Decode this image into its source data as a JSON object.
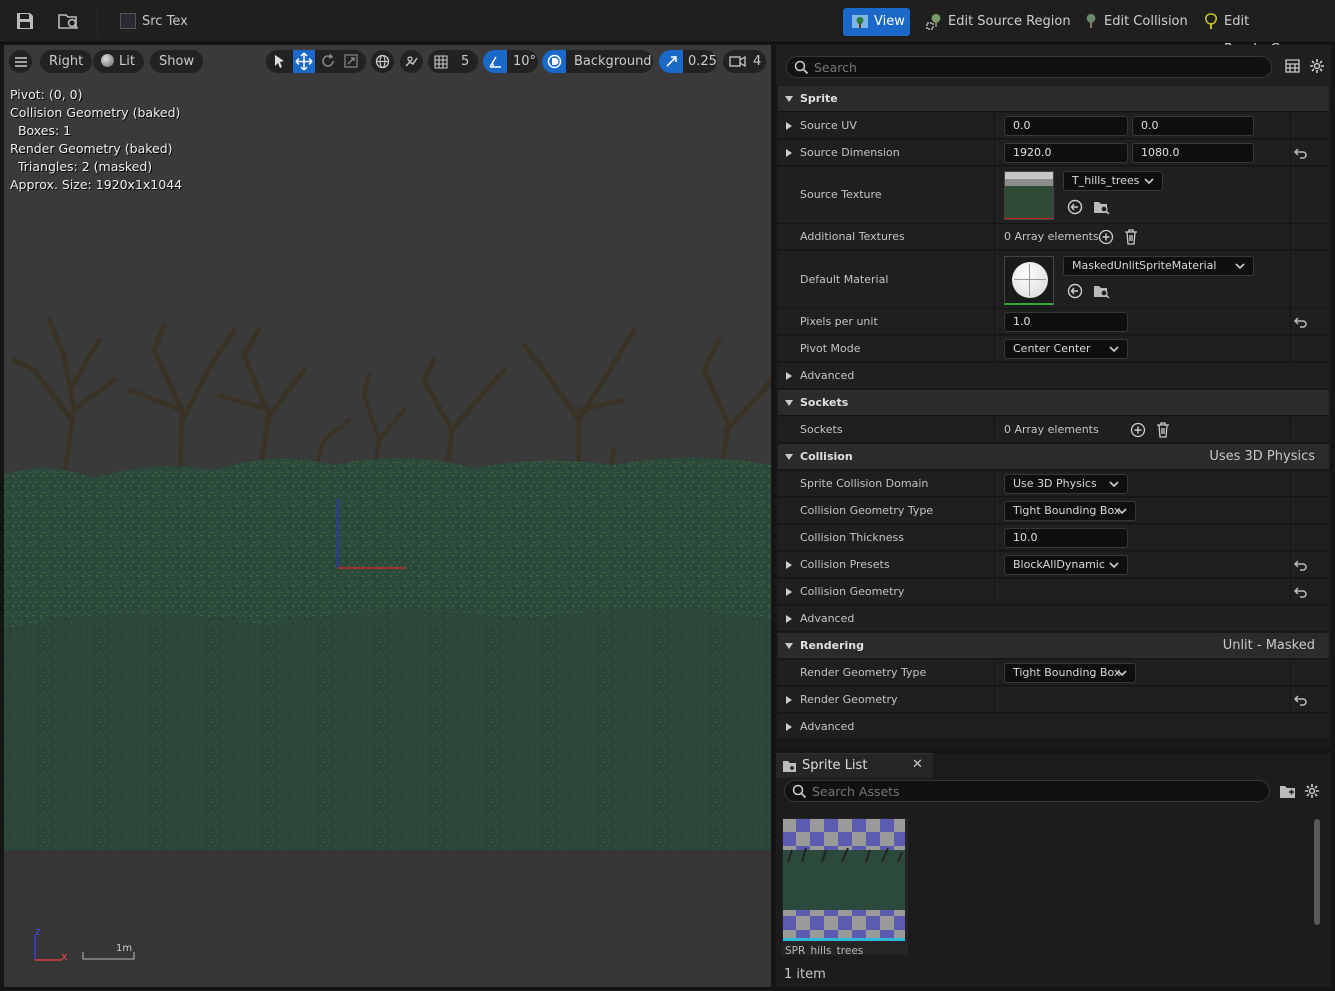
{
  "toolbar": {
    "source_texture_tab": "Src Tex",
    "modes": {
      "view": "View",
      "edit_source_region": "Edit Source Region",
      "edit_collision": "Edit Collision",
      "edit_render_geom": "Edit RenderGeom"
    }
  },
  "viewport": {
    "view_mode": "Right",
    "lighting": "Lit",
    "show": "Show",
    "grid_snap": "5",
    "rotation_snap": "10°",
    "background": "Background",
    "scale_snap": "0.25",
    "camera_speed": "4",
    "info": {
      "pivot": "Pivot: (0, 0)",
      "collision_geometry": "Collision Geometry (baked)",
      "boxes": "  Boxes: 1",
      "render_geometry": "Render Geometry (baked)",
      "triangles": "  Triangles: 2 (masked)",
      "approx_size": "Approx. Size: 1920x1x1044"
    },
    "scale_label": "1m",
    "axis_z": "z",
    "axis_x": "x"
  },
  "details": {
    "search_placeholder": "Search",
    "sprite": {
      "category": "Sprite",
      "source_uv": {
        "label": "Source UV",
        "x": "0.0",
        "y": "0.0"
      },
      "source_dimension": {
        "label": "Source Dimension",
        "x": "1920.0",
        "y": "1080.0"
      },
      "source_texture": {
        "label": "Source Texture",
        "value": "T_hills_trees"
      },
      "additional_textures": {
        "label": "Additional Textures",
        "value": "0 Array elements"
      },
      "default_material": {
        "label": "Default Material",
        "value": "MaskedUnlitSpriteMaterial"
      },
      "pixels_per_unit": {
        "label": "Pixels per unit",
        "value": "1.0"
      },
      "pivot_mode": {
        "label": "Pivot Mode",
        "value": "Center Center"
      },
      "advanced": "Advanced"
    },
    "sockets": {
      "category": "Sockets",
      "sockets": {
        "label": "Sockets",
        "value": "0 Array elements"
      }
    },
    "collision": {
      "category": "Collision",
      "summary": "Uses 3D Physics",
      "domain": {
        "label": "Sprite Collision Domain",
        "value": "Use 3D Physics"
      },
      "geometry_type": {
        "label": "Collision Geometry Type",
        "value": "Tight Bounding Box"
      },
      "thickness": {
        "label": "Collision Thickness",
        "value": "10.0"
      },
      "presets": {
        "label": "Collision Presets",
        "value": "BlockAllDynamic"
      },
      "geometry": "Collision Geometry",
      "advanced": "Advanced"
    },
    "rendering": {
      "category": "Rendering",
      "summary": "Unlit - Masked",
      "geometry_type": {
        "label": "Render Geometry Type",
        "value": "Tight Bounding Box"
      },
      "geometry": "Render Geometry",
      "advanced": "Advanced"
    }
  },
  "sprite_list": {
    "tab_title": "Sprite List",
    "search_placeholder": "Search Assets",
    "items": [
      {
        "name": "SPR_hills_trees"
      }
    ],
    "count": "1 item"
  },
  "colors": {
    "accent_blue": "#1a69c9",
    "grass_dark": "#2c4a3c",
    "tree_brown": "#3a3224"
  }
}
